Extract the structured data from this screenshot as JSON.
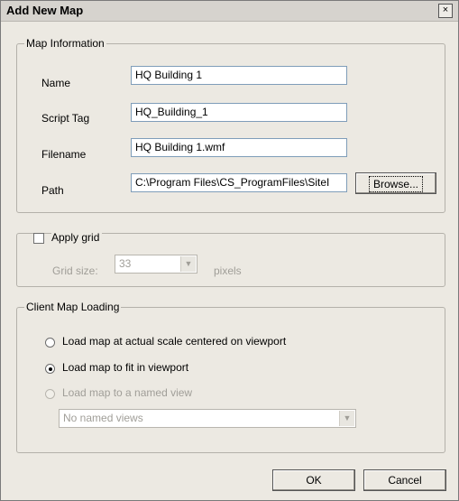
{
  "window": {
    "title": "Add New Map",
    "close_label": "×"
  },
  "map_info": {
    "legend": "Map Information",
    "name_label": "Name",
    "name_value": "HQ Building 1",
    "script_tag_label": "Script Tag",
    "script_tag_value": "HQ_Building_1",
    "filename_label": "Filename",
    "filename_value": "HQ Building 1.wmf",
    "path_label": "Path",
    "path_value": "C:\\Program Files\\CS_ProgramFiles\\SiteI",
    "browse_label": "Browse..."
  },
  "grid": {
    "checkbox_label": "Apply grid",
    "size_label": "Grid size:",
    "size_value": "33",
    "units_label": "pixels"
  },
  "loading": {
    "legend": "Client Map Loading",
    "option_actual": "Load map at actual scale centered on viewport",
    "option_fit": "Load map to fit in viewport",
    "option_named": "Load map to a named view",
    "named_select_value": "No named views",
    "selected": "Load map to fit in viewport"
  },
  "footer": {
    "ok_label": "OK",
    "cancel_label": "Cancel"
  },
  "icons": {
    "dropdown": "chevron-down-icon"
  }
}
